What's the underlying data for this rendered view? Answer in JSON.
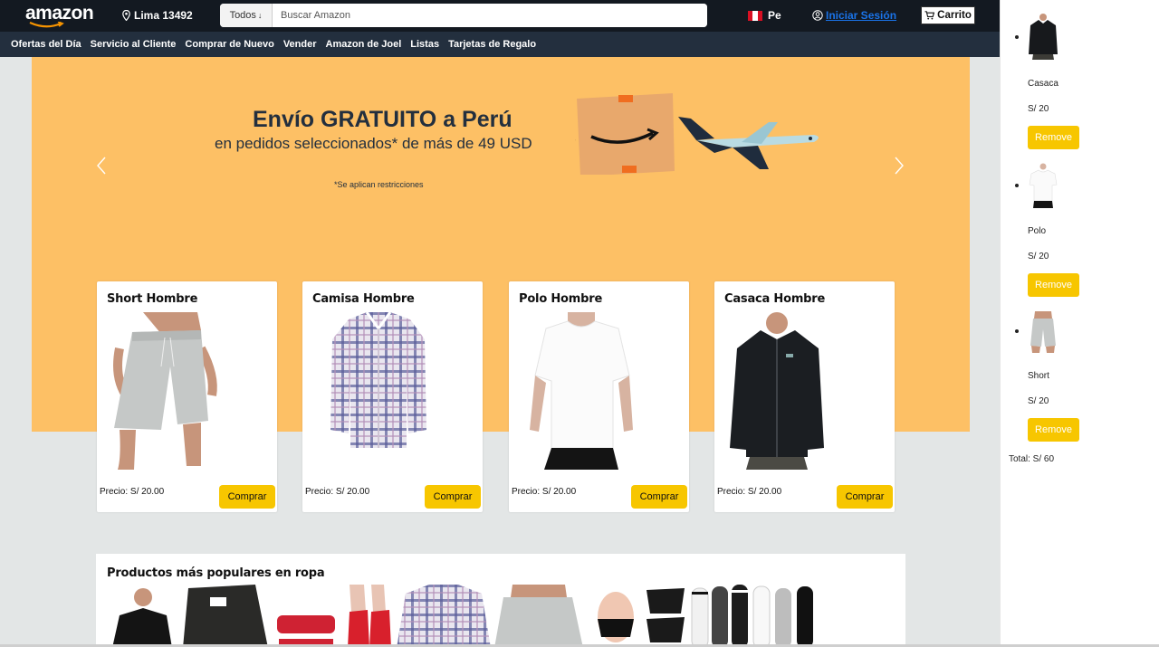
{
  "header": {
    "logo": "amazon",
    "location": "Lima 13492",
    "search": {
      "category": "Todos",
      "placeholder": "Buscar Amazon"
    },
    "language": "Pe",
    "signin": "Iniciar Sesión",
    "cart": "Carrito"
  },
  "nav": [
    "Ofertas del Día",
    "Servicio al Cliente",
    "Comprar de Nuevo",
    "Vender",
    "Amazon de Joel",
    "Listas",
    "Tarjetas de Regalo"
  ],
  "hero": {
    "title": "Envío GRATUITO a Perú",
    "subtitle": "en pedidos seleccionados* de más de 49 USD",
    "note": "*Se aplican restricciones"
  },
  "products": [
    {
      "title": "Short Hombre",
      "price": "Precio: S/ 20.00",
      "button": "Comprar",
      "icon": "shorts-image"
    },
    {
      "title": "Camisa Hombre",
      "price": "Precio: S/ 20.00",
      "button": "Comprar",
      "icon": "plaid-shirt-image"
    },
    {
      "title": "Polo Hombre",
      "price": "Precio: S/ 20.00",
      "button": "Comprar",
      "icon": "tshirt-image"
    },
    {
      "title": "Casaca Hombre",
      "price": "Precio: S/ 20.00",
      "button": "Comprar",
      "icon": "jacket-image"
    }
  ],
  "popular": {
    "title": "Productos más populares en ropa"
  },
  "cart": {
    "items": [
      {
        "name": "Casaca",
        "price": "S/ 20",
        "button": "Remove"
      },
      {
        "name": "Polo",
        "price": "S/ 20",
        "button": "Remove"
      },
      {
        "name": "Short",
        "price": "S/ 20",
        "button": "Remove"
      }
    ],
    "total": "Total: S/ 60"
  },
  "colors": {
    "topbar": "#131921",
    "navbar": "#232f3e",
    "hero_bg": "#fdc065",
    "button": "#f7c600",
    "link": "#1a73e8"
  }
}
